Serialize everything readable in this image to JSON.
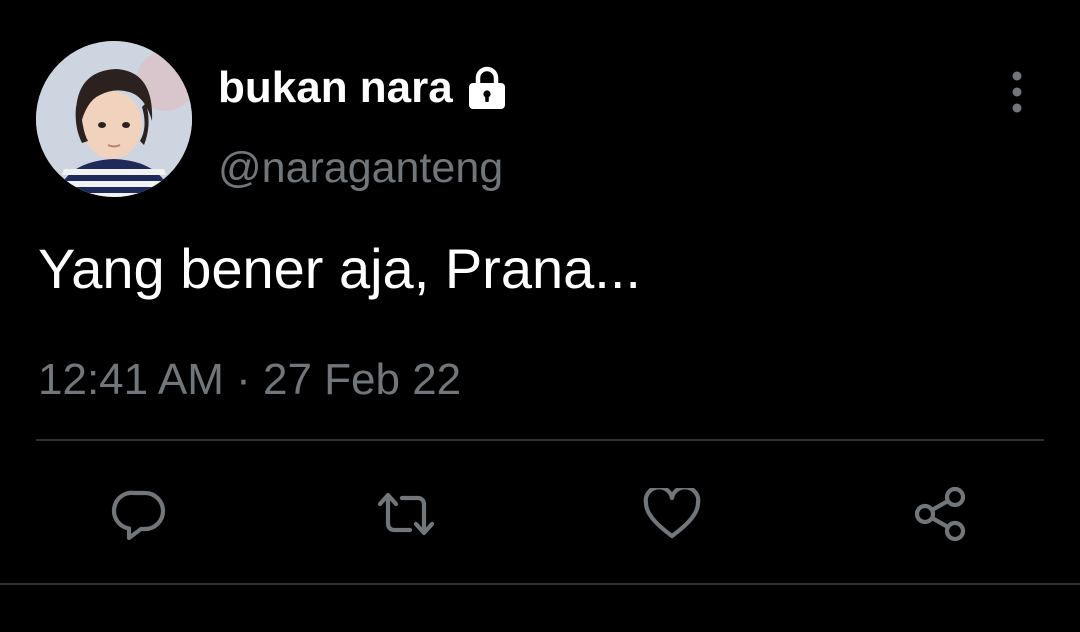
{
  "tweet": {
    "author": {
      "display_name": "bukan nara",
      "handle": "@naraganteng",
      "protected_icon": "lock-icon"
    },
    "text": "Yang bener aja, Prana...",
    "timestamp": "12:41 AM · 27 Feb 22",
    "actions": [
      {
        "name": "reply",
        "icon": "reply-icon"
      },
      {
        "name": "retweet",
        "icon": "retweet-icon"
      },
      {
        "name": "like",
        "icon": "heart-icon"
      },
      {
        "name": "share",
        "icon": "share-icon"
      }
    ]
  },
  "colors": {
    "background": "#000000",
    "primary_text": "#ffffff",
    "secondary_text": "#71767b",
    "divider": "#2f3336"
  }
}
